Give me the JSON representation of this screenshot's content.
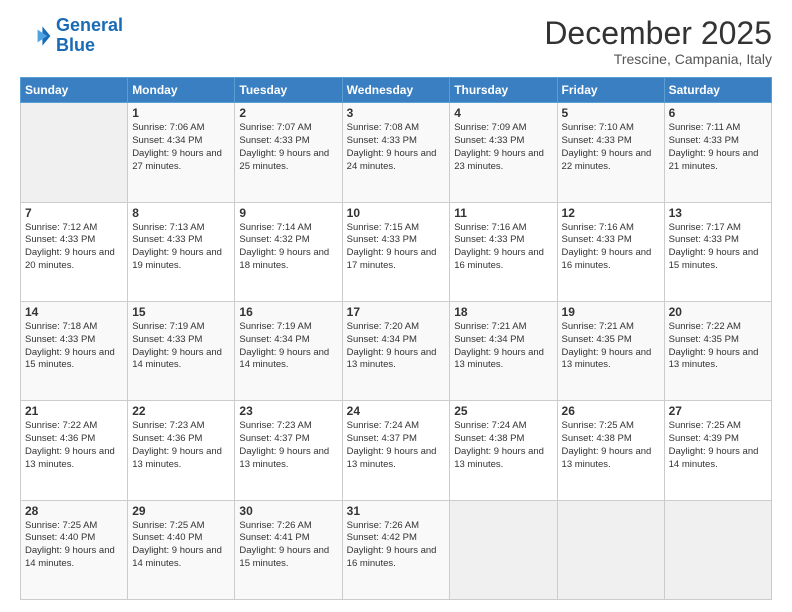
{
  "header": {
    "logo_line1": "General",
    "logo_line2": "Blue",
    "month_title": "December 2025",
    "location": "Trescine, Campania, Italy"
  },
  "weekdays": [
    "Sunday",
    "Monday",
    "Tuesday",
    "Wednesday",
    "Thursday",
    "Friday",
    "Saturday"
  ],
  "weeks": [
    [
      {
        "num": "",
        "sunrise": "",
        "sunset": "",
        "daylight": ""
      },
      {
        "num": "1",
        "sunrise": "Sunrise: 7:06 AM",
        "sunset": "Sunset: 4:34 PM",
        "daylight": "Daylight: 9 hours and 27 minutes."
      },
      {
        "num": "2",
        "sunrise": "Sunrise: 7:07 AM",
        "sunset": "Sunset: 4:33 PM",
        "daylight": "Daylight: 9 hours and 25 minutes."
      },
      {
        "num": "3",
        "sunrise": "Sunrise: 7:08 AM",
        "sunset": "Sunset: 4:33 PM",
        "daylight": "Daylight: 9 hours and 24 minutes."
      },
      {
        "num": "4",
        "sunrise": "Sunrise: 7:09 AM",
        "sunset": "Sunset: 4:33 PM",
        "daylight": "Daylight: 9 hours and 23 minutes."
      },
      {
        "num": "5",
        "sunrise": "Sunrise: 7:10 AM",
        "sunset": "Sunset: 4:33 PM",
        "daylight": "Daylight: 9 hours and 22 minutes."
      },
      {
        "num": "6",
        "sunrise": "Sunrise: 7:11 AM",
        "sunset": "Sunset: 4:33 PM",
        "daylight": "Daylight: 9 hours and 21 minutes."
      }
    ],
    [
      {
        "num": "7",
        "sunrise": "Sunrise: 7:12 AM",
        "sunset": "Sunset: 4:33 PM",
        "daylight": "Daylight: 9 hours and 20 minutes."
      },
      {
        "num": "8",
        "sunrise": "Sunrise: 7:13 AM",
        "sunset": "Sunset: 4:33 PM",
        "daylight": "Daylight: 9 hours and 19 minutes."
      },
      {
        "num": "9",
        "sunrise": "Sunrise: 7:14 AM",
        "sunset": "Sunset: 4:32 PM",
        "daylight": "Daylight: 9 hours and 18 minutes."
      },
      {
        "num": "10",
        "sunrise": "Sunrise: 7:15 AM",
        "sunset": "Sunset: 4:33 PM",
        "daylight": "Daylight: 9 hours and 17 minutes."
      },
      {
        "num": "11",
        "sunrise": "Sunrise: 7:16 AM",
        "sunset": "Sunset: 4:33 PM",
        "daylight": "Daylight: 9 hours and 16 minutes."
      },
      {
        "num": "12",
        "sunrise": "Sunrise: 7:16 AM",
        "sunset": "Sunset: 4:33 PM",
        "daylight": "Daylight: 9 hours and 16 minutes."
      },
      {
        "num": "13",
        "sunrise": "Sunrise: 7:17 AM",
        "sunset": "Sunset: 4:33 PM",
        "daylight": "Daylight: 9 hours and 15 minutes."
      }
    ],
    [
      {
        "num": "14",
        "sunrise": "Sunrise: 7:18 AM",
        "sunset": "Sunset: 4:33 PM",
        "daylight": "Daylight: 9 hours and 15 minutes."
      },
      {
        "num": "15",
        "sunrise": "Sunrise: 7:19 AM",
        "sunset": "Sunset: 4:33 PM",
        "daylight": "Daylight: 9 hours and 14 minutes."
      },
      {
        "num": "16",
        "sunrise": "Sunrise: 7:19 AM",
        "sunset": "Sunset: 4:34 PM",
        "daylight": "Daylight: 9 hours and 14 minutes."
      },
      {
        "num": "17",
        "sunrise": "Sunrise: 7:20 AM",
        "sunset": "Sunset: 4:34 PM",
        "daylight": "Daylight: 9 hours and 13 minutes."
      },
      {
        "num": "18",
        "sunrise": "Sunrise: 7:21 AM",
        "sunset": "Sunset: 4:34 PM",
        "daylight": "Daylight: 9 hours and 13 minutes."
      },
      {
        "num": "19",
        "sunrise": "Sunrise: 7:21 AM",
        "sunset": "Sunset: 4:35 PM",
        "daylight": "Daylight: 9 hours and 13 minutes."
      },
      {
        "num": "20",
        "sunrise": "Sunrise: 7:22 AM",
        "sunset": "Sunset: 4:35 PM",
        "daylight": "Daylight: 9 hours and 13 minutes."
      }
    ],
    [
      {
        "num": "21",
        "sunrise": "Sunrise: 7:22 AM",
        "sunset": "Sunset: 4:36 PM",
        "daylight": "Daylight: 9 hours and 13 minutes."
      },
      {
        "num": "22",
        "sunrise": "Sunrise: 7:23 AM",
        "sunset": "Sunset: 4:36 PM",
        "daylight": "Daylight: 9 hours and 13 minutes."
      },
      {
        "num": "23",
        "sunrise": "Sunrise: 7:23 AM",
        "sunset": "Sunset: 4:37 PM",
        "daylight": "Daylight: 9 hours and 13 minutes."
      },
      {
        "num": "24",
        "sunrise": "Sunrise: 7:24 AM",
        "sunset": "Sunset: 4:37 PM",
        "daylight": "Daylight: 9 hours and 13 minutes."
      },
      {
        "num": "25",
        "sunrise": "Sunrise: 7:24 AM",
        "sunset": "Sunset: 4:38 PM",
        "daylight": "Daylight: 9 hours and 13 minutes."
      },
      {
        "num": "26",
        "sunrise": "Sunrise: 7:25 AM",
        "sunset": "Sunset: 4:38 PM",
        "daylight": "Daylight: 9 hours and 13 minutes."
      },
      {
        "num": "27",
        "sunrise": "Sunrise: 7:25 AM",
        "sunset": "Sunset: 4:39 PM",
        "daylight": "Daylight: 9 hours and 14 minutes."
      }
    ],
    [
      {
        "num": "28",
        "sunrise": "Sunrise: 7:25 AM",
        "sunset": "Sunset: 4:40 PM",
        "daylight": "Daylight: 9 hours and 14 minutes."
      },
      {
        "num": "29",
        "sunrise": "Sunrise: 7:25 AM",
        "sunset": "Sunset: 4:40 PM",
        "daylight": "Daylight: 9 hours and 14 minutes."
      },
      {
        "num": "30",
        "sunrise": "Sunrise: 7:26 AM",
        "sunset": "Sunset: 4:41 PM",
        "daylight": "Daylight: 9 hours and 15 minutes."
      },
      {
        "num": "31",
        "sunrise": "Sunrise: 7:26 AM",
        "sunset": "Sunset: 4:42 PM",
        "daylight": "Daylight: 9 hours and 16 minutes."
      },
      {
        "num": "",
        "sunrise": "",
        "sunset": "",
        "daylight": ""
      },
      {
        "num": "",
        "sunrise": "",
        "sunset": "",
        "daylight": ""
      },
      {
        "num": "",
        "sunrise": "",
        "sunset": "",
        "daylight": ""
      }
    ]
  ]
}
